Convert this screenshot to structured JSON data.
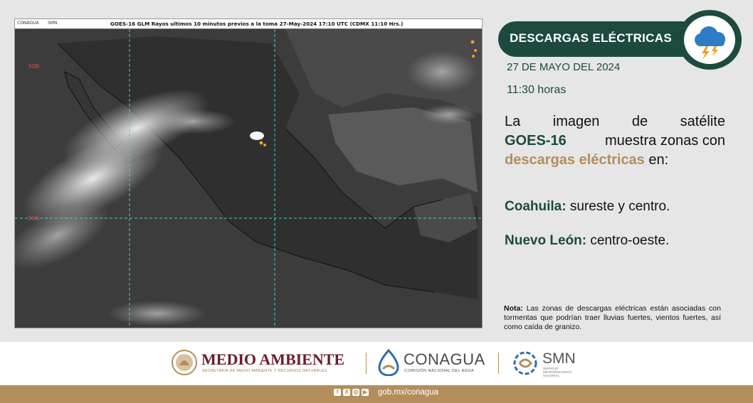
{
  "satellite": {
    "logo_left": "CONAGUA",
    "logo_right": "SMN",
    "title": "GOES-16 GLM Rayos ultimos 10 minutos previos a la toma 27-May-2024 17:10 UTC  (CDMX  11:10 Hrs.)",
    "lat_30": "30N",
    "lat_20": "20N"
  },
  "header": {
    "title": "DESCARGAS ELÉCTRICAS",
    "icon": "storm-cloud-lightning-icon",
    "date": "27 DE MAYO DEL 2024",
    "time": "11:30 horas"
  },
  "body": {
    "w1": "La",
    "w2": "imagen",
    "w3": "de",
    "w4": "satélite",
    "goes": "GOES-16",
    "rest2": "muestra zonas con",
    "descargas": "descargas eléctricas",
    "en": "en:"
  },
  "states": [
    {
      "name": "Coahuila:",
      "detail": "sureste y centro."
    },
    {
      "name": "Nuevo León:",
      "detail": "centro-oeste."
    }
  ],
  "note": {
    "label": "Nota:",
    "text": "Las zonas de descargas eléctricas están asociadas con tormentas que podrían traer lluvias fuertes, vientos fuertes, así como caída de granizo."
  },
  "footer": {
    "medio_ambiente": "MEDIO AMBIENTE",
    "medio_ambiente_sub": "SECRETARÍA DE MEDIO AMBIENTE Y RECURSOS NATURALES",
    "conagua": "CONAGUA",
    "conagua_sub": "COMISIÓN NACIONAL DEL AGUA",
    "smn": "SMN",
    "smn_sub1": "SERVICIO",
    "smn_sub2": "METEOROLÓGICO",
    "smn_sub3": "NACIONAL",
    "url": "gob.mx/conagua"
  },
  "colors": {
    "primary_green": "#1c4a3f",
    "gold": "#b38e5d",
    "lightning_orange": "#f0a020"
  }
}
